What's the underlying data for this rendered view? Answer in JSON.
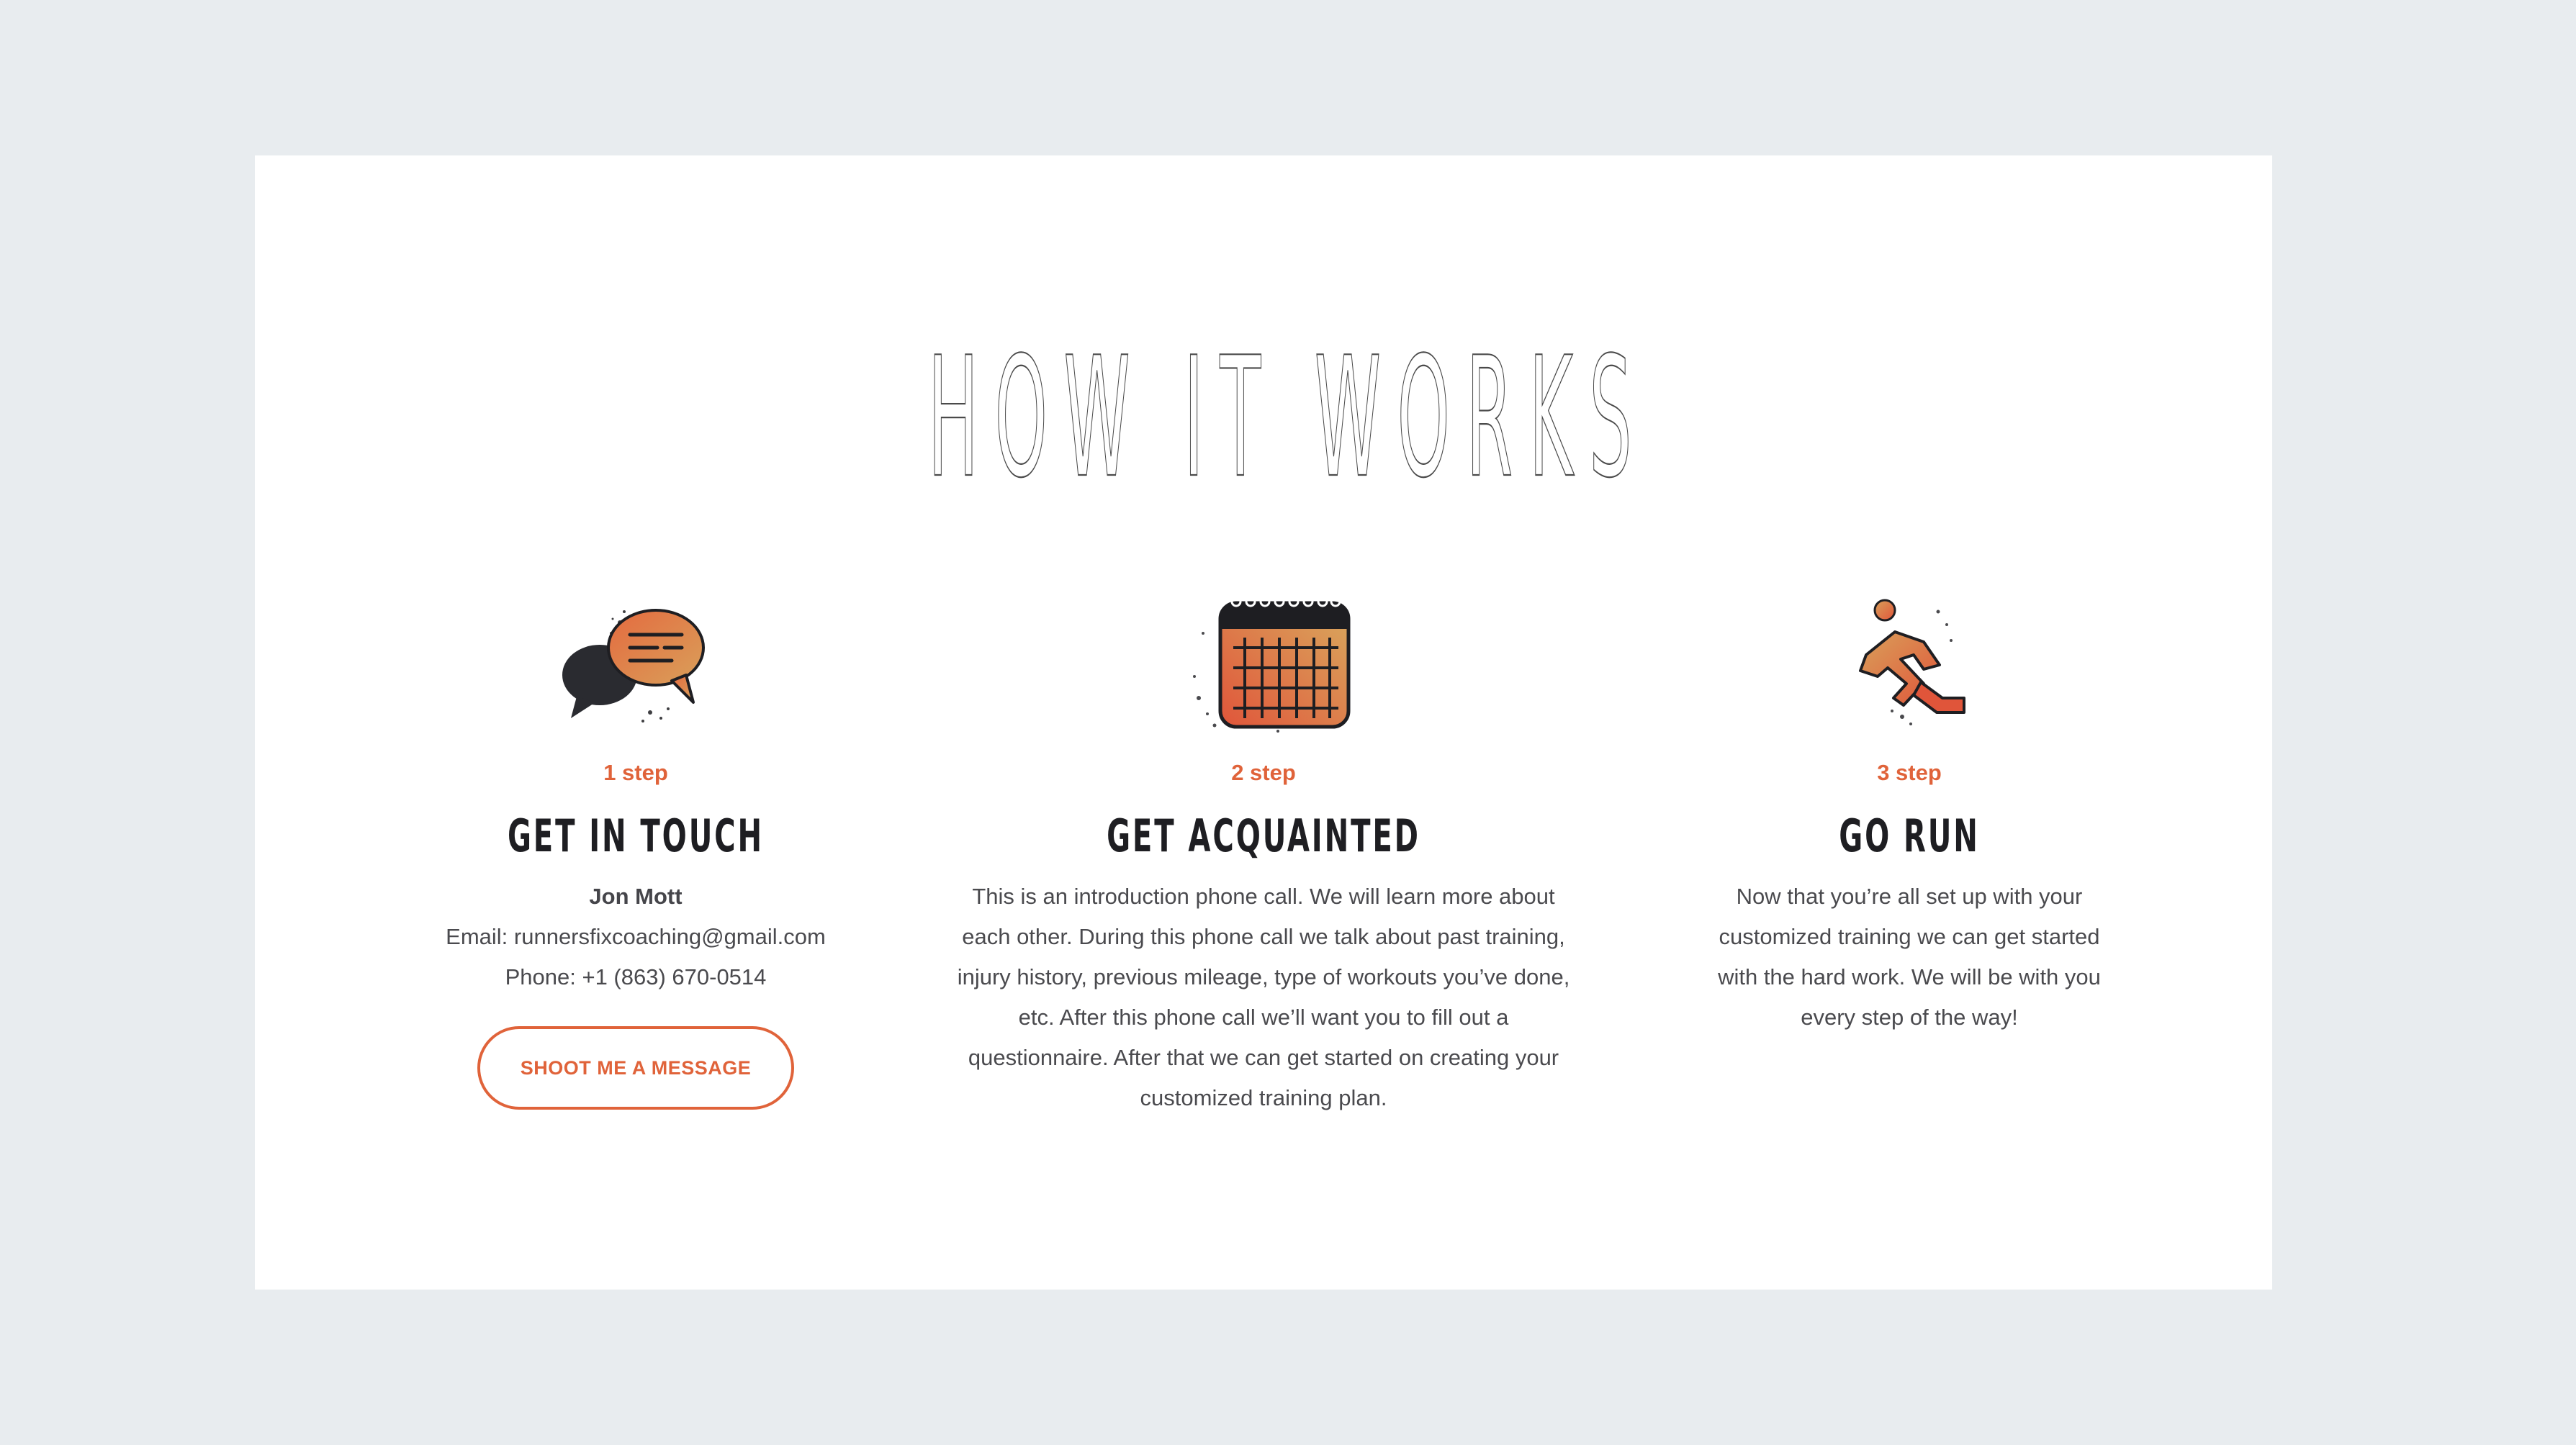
{
  "section": {
    "title": "HOW IT WORKS"
  },
  "colors": {
    "accent": "#e0633a",
    "background": "#e8ecef",
    "card": "#ffffff",
    "heading": "#1e1e22",
    "text": "#4a4a4e"
  },
  "steps": [
    {
      "icon": "speech-bubbles-icon",
      "step_label": "1 step",
      "heading": "GET IN TOUCH",
      "contact": {
        "name": "Jon Mott",
        "email": "Email: runnersfixcoaching@gmail.com",
        "phone": "Phone: +1 (863) 670-0514"
      },
      "button_label": "SHOOT ME A MESSAGE"
    },
    {
      "icon": "calendar-icon",
      "step_label": "2 step",
      "heading": "GET ACQUAINTED",
      "description": "This is an introduction phone call. We will learn more about each other. During this phone call we talk about past training, injury history, previous mileage, type of workouts you’ve done, etc. After this phone call we’ll want you to fill out a questionnaire. After that we can get started on creating your customized training plan."
    },
    {
      "icon": "runner-icon",
      "step_label": "3 step",
      "heading": "GO RUN",
      "description": "Now that you’re all set up with your customized training we can get started with the hard work. We will be with you every step of the way!"
    }
  ]
}
